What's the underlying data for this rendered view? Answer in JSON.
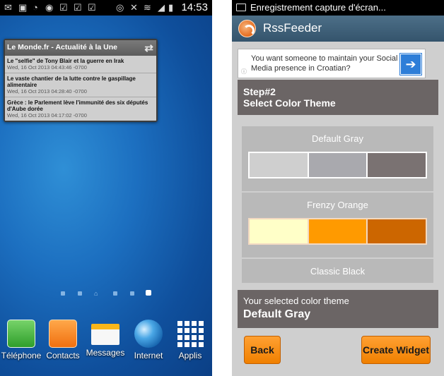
{
  "left_screen": {
    "status_bar": {
      "time": "14:53"
    },
    "widget": {
      "title": "Le Monde.fr - Actualité à la Une",
      "items": [
        {
          "title": "Le \"selfie\" de Tony Blair et la guerre en Irak",
          "date": "Wed, 16 Oct 2013 04:43:46 -0700"
        },
        {
          "title": "Le vaste chantier de la lutte contre le gaspillage alimentaire",
          "date": "Wed, 16 Oct 2013 04:28:40 -0700"
        },
        {
          "title": "Grèce : le Parlement lève l'immunité des six députés d'Aube dorée",
          "date": "Wed, 16 Oct 2013 04:17:02 -0700"
        }
      ]
    },
    "dock": [
      {
        "label": "Téléphone",
        "icon": "phone-icon"
      },
      {
        "label": "Contacts",
        "icon": "contacts-icon"
      },
      {
        "label": "Messages",
        "icon": "messages-icon"
      },
      {
        "label": "Internet",
        "icon": "globe-icon"
      },
      {
        "label": "Applis",
        "icon": "apps-grid-icon"
      }
    ]
  },
  "right_screen": {
    "status_bar": {
      "text": "Enregistrement capture d'écran..."
    },
    "app_bar": {
      "title": "RssFeeder"
    },
    "ad": {
      "text": "You want someone to maintain your Social Media presence in Croatian?",
      "info": "ⓘ"
    },
    "step": {
      "line1": "Step#2",
      "line2": "Select Color Theme"
    },
    "themes": [
      {
        "name": "Default Gray",
        "colors": [
          "#cfcfcf",
          "#a9a9ae",
          "#7a7272"
        ]
      },
      {
        "name": "Frenzy Orange",
        "colors": [
          "#ffffc8",
          "#ff9a00",
          "#cc6600"
        ]
      },
      {
        "name": "Classic Black",
        "colors": []
      }
    ],
    "selected": {
      "caption": "Your selected color theme",
      "value": "Default Gray"
    },
    "buttons": {
      "back": "Back",
      "create": "Create Widget"
    },
    "colors": {
      "accent": "#f08000",
      "app_bar": "#3f6078",
      "panel": "#6b6565"
    }
  }
}
